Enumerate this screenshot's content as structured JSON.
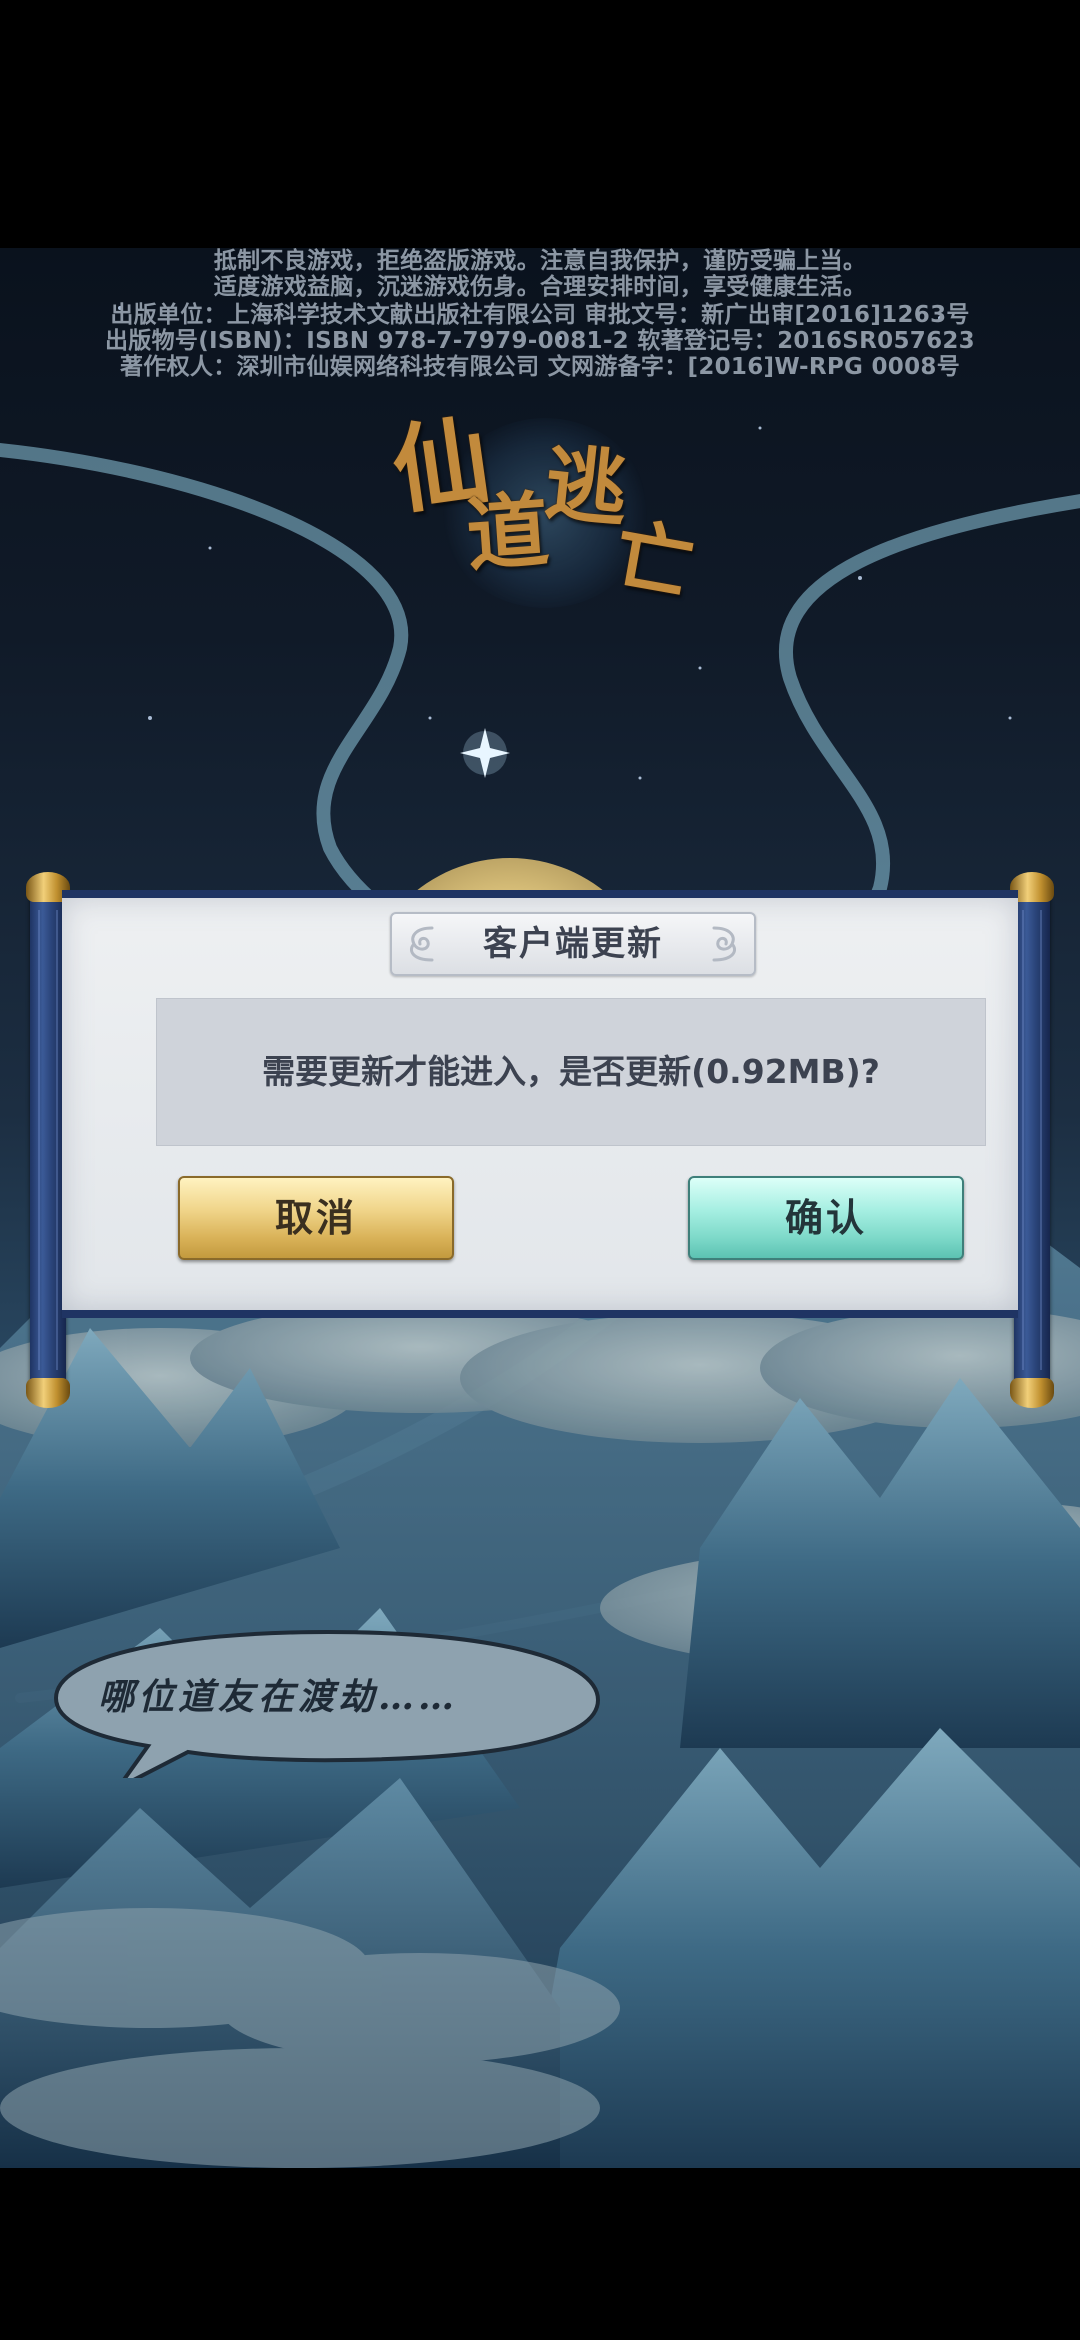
{
  "notice": {
    "line1": "抵制不良游戏，拒绝盗版游戏。注意自我保护，谨防受骗上当。",
    "line2": "适度游戏益脑，沉迷游戏伤身。合理安排时间，享受健康生活。",
    "line3": "出版单位：上海科学技术文献出版社有限公司 审批文号：新广出审[2016]1263号",
    "line4": "出版物号(ISBN)：ISBN 978-7-7979-0081-2  软著登记号：2016SR057623",
    "line5": "著作权人：深圳市仙娱网络科技有限公司  文网游备字：[2016]W-RPG 0008号"
  },
  "logo": {
    "chars": [
      "仙",
      "道",
      "逃",
      "亡"
    ]
  },
  "dialog": {
    "title": "客户端更新",
    "message": "需要更新才能进入，是否更新(0.92MB)?",
    "cancel_label": "取消",
    "confirm_label": "确认"
  },
  "bubble": {
    "text": "哪位道友在渡劫……"
  },
  "colors": {
    "notice_text": "#8c97a4",
    "logo_gold": "#c28a3c",
    "rod_blue": "#1f3463",
    "cancel_gold": "#f0d58a",
    "confirm_teal": "#a6efe2"
  }
}
